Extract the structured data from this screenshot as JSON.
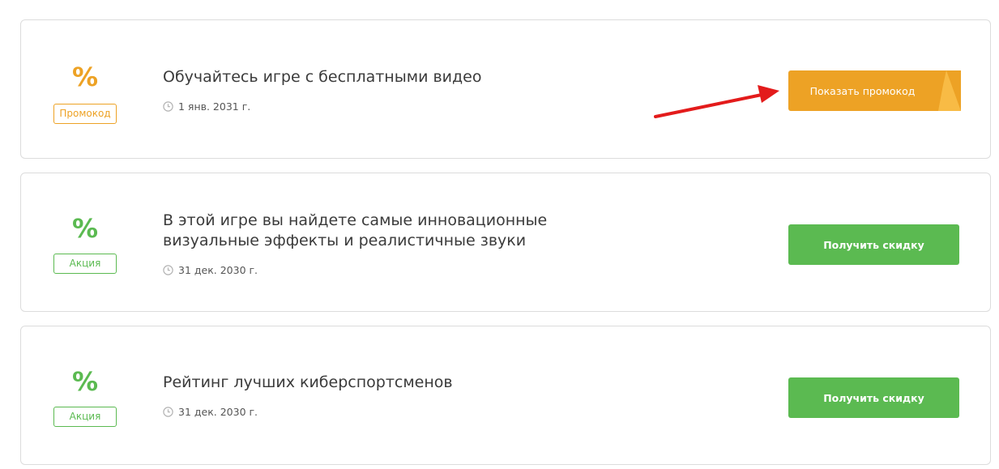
{
  "offers": [
    {
      "percent_symbol": "%",
      "tag_label": "Промокод",
      "title": "Обучайтесь игре с бесплатными видео",
      "date": "1 янв. 2031 г.",
      "button_label": "Показать промокод",
      "accent_color": "#eda225"
    },
    {
      "percent_symbol": "%",
      "tag_label": "Акция",
      "title": "В этой игре вы найдете самые инновационные визуальные эффекты и реалистичные звуки",
      "date": "31 дек. 2030 г.",
      "button_label": "Получить скидку",
      "accent_color": "#5bba51"
    },
    {
      "percent_symbol": "%",
      "tag_label": "Акция",
      "title": "Рейтинг лучших киберспортсменов",
      "date": "31 дек. 2030 г.",
      "button_label": "Получить скидку",
      "accent_color": "#5bba51"
    }
  ],
  "annotation_arrow_color": "#e31b1b",
  "icons": {
    "date_icon": "clock-icon"
  }
}
